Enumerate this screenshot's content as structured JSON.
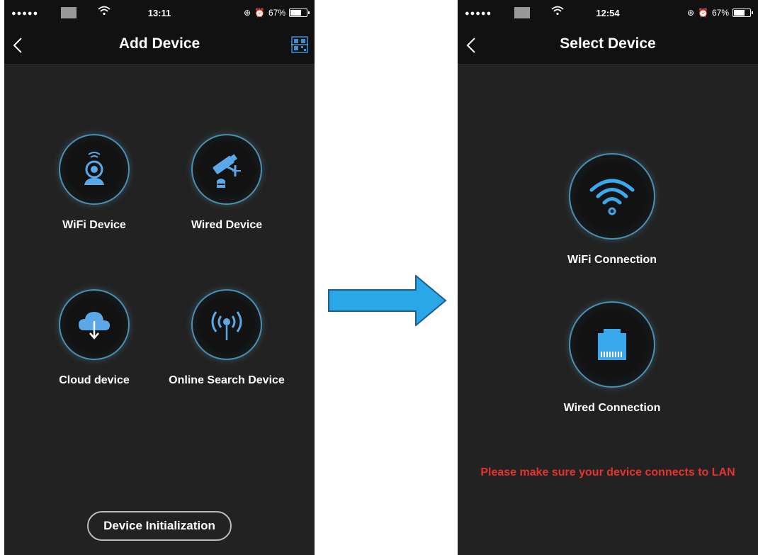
{
  "left_screen": {
    "status": {
      "signal": "●●●●●",
      "time": "13:11",
      "battery": "67%",
      "battery_level": 0.67
    },
    "nav": {
      "title": "Add Device"
    },
    "devices": [
      {
        "label": "WiFi Device",
        "icon": "wifi-camera-icon"
      },
      {
        "label": "Wired Device",
        "icon": "security-camera-icon"
      },
      {
        "label": "Cloud device",
        "icon": "cloud-download-icon"
      },
      {
        "label": "Online Search Device",
        "icon": "broadcast-signal-icon"
      }
    ],
    "init_button": "Device Initialization"
  },
  "right_screen": {
    "status": {
      "signal": "●●●●●",
      "time": "12:54",
      "battery": "67%",
      "battery_level": 0.67
    },
    "nav": {
      "title": "Select Device"
    },
    "options": [
      {
        "label": "WiFi Connection",
        "icon": "wifi-icon"
      },
      {
        "label": "Wired Connection",
        "icon": "ethernet-port-icon"
      }
    ],
    "warning": "Please make sure your device connects to LAN"
  },
  "colors": {
    "accent": "#4aa8e8",
    "background": "#222222",
    "bar": "#111111",
    "warning": "#e8322f",
    "arrow": "#2aa7e6"
  }
}
